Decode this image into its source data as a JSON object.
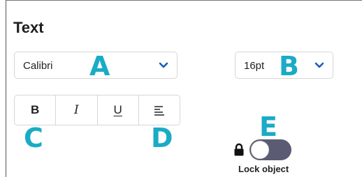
{
  "panel": {
    "title": "Text"
  },
  "font_select": {
    "value": "Calibri",
    "icon": "chevron-down-icon"
  },
  "size_select": {
    "value": "16pt",
    "icon": "chevron-down-icon"
  },
  "format_buttons": {
    "bold": "B",
    "italic": "I",
    "underline": "U",
    "align_icon": "align-left-icon"
  },
  "lock": {
    "label": "Lock object",
    "icon": "lock-icon",
    "toggle_on": false
  },
  "markers": {
    "a": "A",
    "b": "B",
    "c": "C",
    "d": "D",
    "e": "E"
  },
  "colors": {
    "marker": "#1aabc6",
    "chevron": "#1a5fb4",
    "toggle": "#5b5b73"
  }
}
